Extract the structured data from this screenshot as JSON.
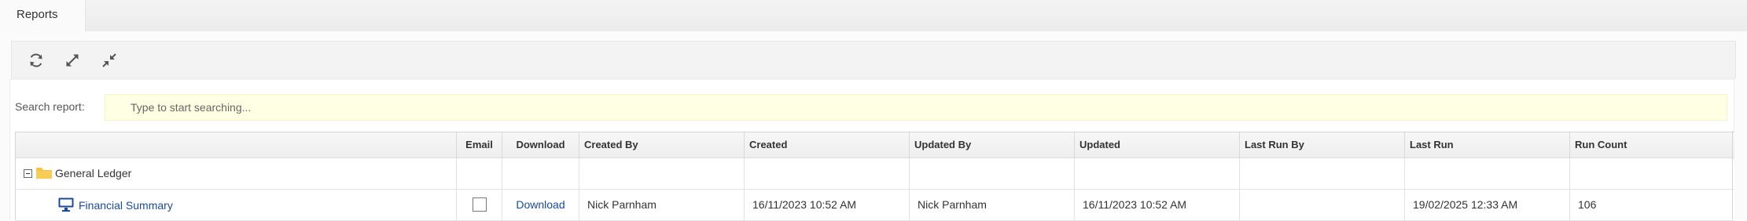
{
  "tabs": [
    {
      "label": "Reports"
    }
  ],
  "toolbar": {
    "refresh_icon": "refresh-icon",
    "expand_icon": "expand-icon",
    "collapse_icon": "collapse-icon"
  },
  "search": {
    "label": "Search report:",
    "placeholder": "Type to start searching..."
  },
  "grid": {
    "columns": [
      "",
      "Email",
      "Download",
      "Created By",
      "Created",
      "Updated By",
      "Updated",
      "Last Run By",
      "Last Run",
      "Run Count"
    ],
    "groups": [
      {
        "name": "General Ledger",
        "icon": "folder-icon",
        "rows": [
          {
            "name": "Financial Summary",
            "icon": "monitor-icon",
            "email_checked": false,
            "download": "Download",
            "created_by": "Nick Parnham",
            "created": "16/11/2023 10:52 AM",
            "updated_by": "Nick Parnham",
            "updated": "16/11/2023 10:52 AM",
            "last_run_by": "",
            "last_run": "19/02/2025 12:33 AM",
            "run_count": "106"
          }
        ]
      }
    ]
  },
  "colors": {
    "link": "#1a4a9c",
    "folder": "#f5c242",
    "search_bg": "#ffffe3"
  }
}
